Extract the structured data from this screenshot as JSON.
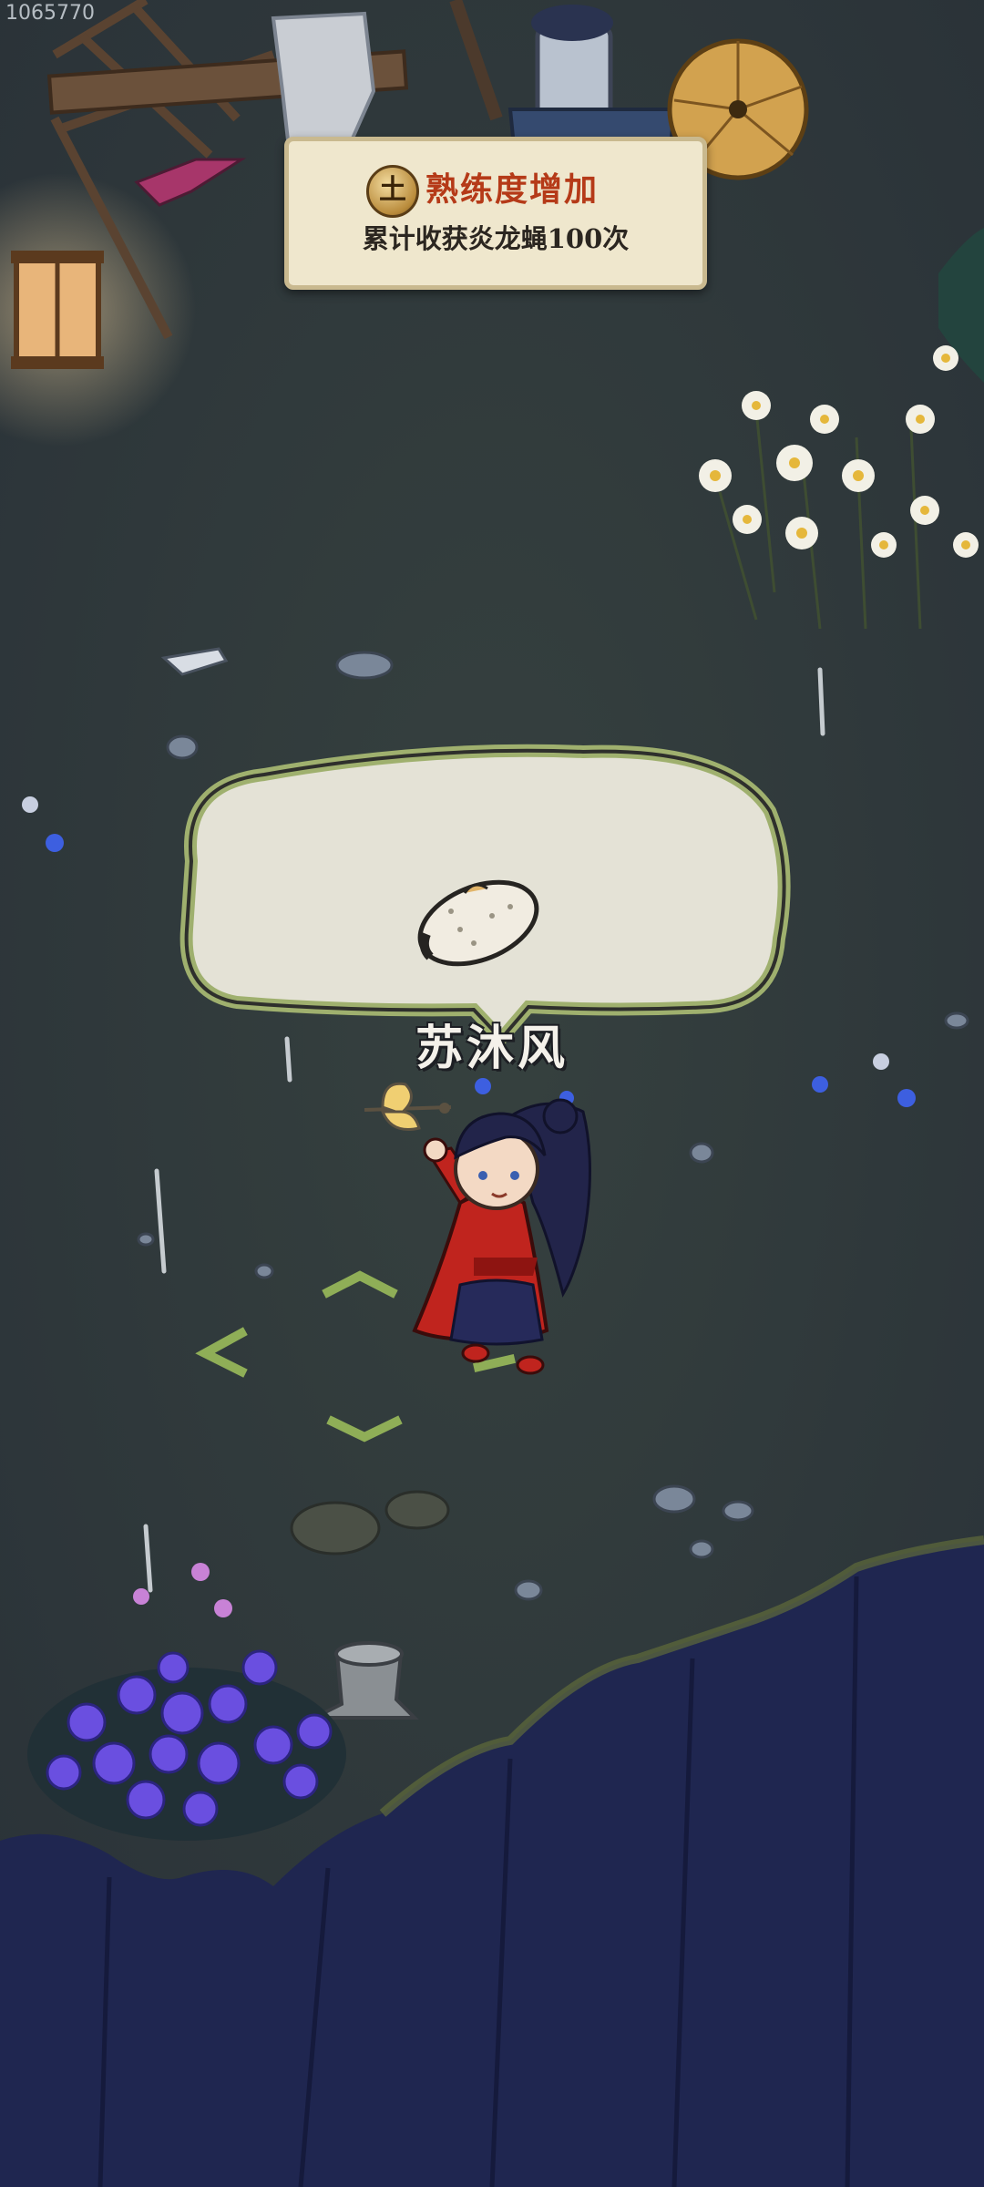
{
  "hud": {
    "id_text": "1065770"
  },
  "toast": {
    "badge_glyph": "土",
    "title": "熟练度增加",
    "description": "累计收获炎龙蝇100次"
  },
  "character": {
    "name": "苏沐风"
  },
  "speech_bubble": {
    "item_icon": "larva-icon"
  },
  "colors": {
    "grass": "#2f3a3f",
    "cliff": "#1f2650",
    "toast_bg": "#efe7cd",
    "toast_title": "#b53a18",
    "bubble_fill": "#e4e2d6",
    "bubble_border": "#9fb06e",
    "move_arrows": "#8fae57",
    "character_robe": "#c0241e"
  }
}
